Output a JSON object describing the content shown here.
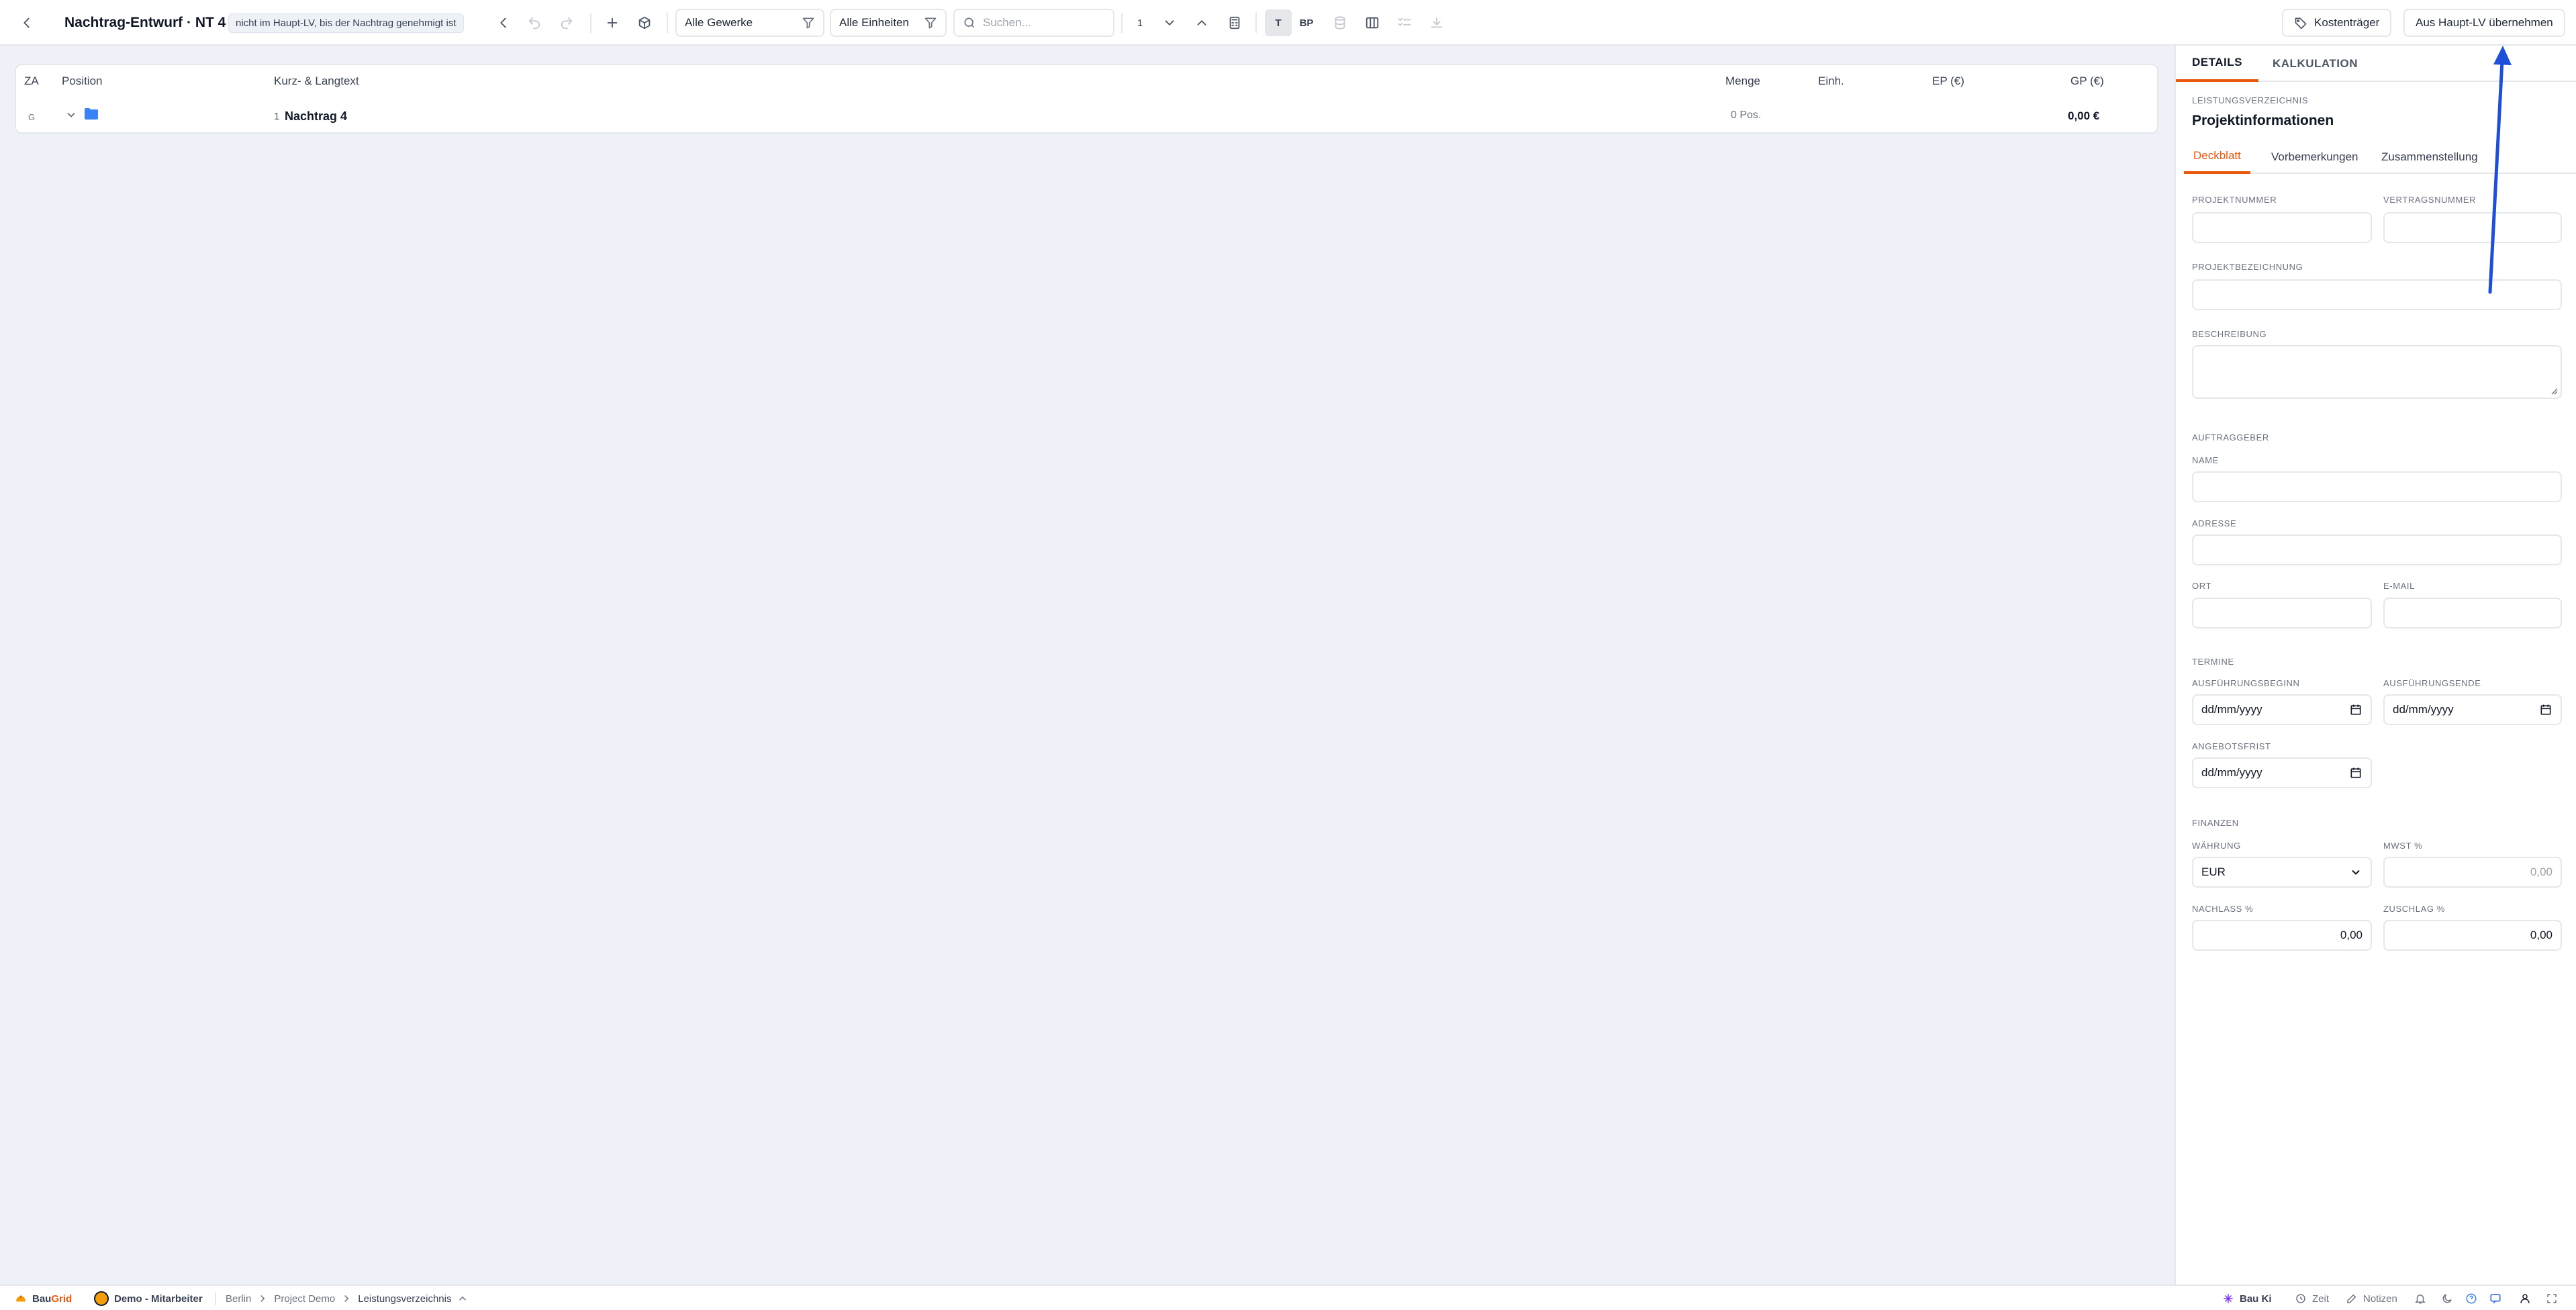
{
  "header": {
    "title": "Nachtrag-Entwurf · NT 4",
    "badge": "nicht im Haupt-LV, bis der Nachtrag genehmigt ist",
    "filter_trades": "Alle Gewerke",
    "filter_units": "Alle Einheiten",
    "search_placeholder": "Suchen...",
    "level_value": "1",
    "toggle_t": "T",
    "toggle_bp": "BP",
    "cost_center_button": "Kostenträger",
    "import_button": "Aus Haupt-LV übernehmen"
  },
  "table": {
    "columns": {
      "za": "ZA",
      "position": "Position",
      "text": "Kurz- & Langtext",
      "quantity": "Menge",
      "unit": "Einh.",
      "ep": "EP (€)",
      "gp": "GP (€)"
    },
    "rows": [
      {
        "za": "G",
        "number": "1",
        "title": "Nachtrag 4",
        "quantity": "0 Pos.",
        "gp": "0,00 €"
      }
    ]
  },
  "panel": {
    "tabs": [
      "DETAILS",
      "KALKULATION"
    ],
    "section_label": "LEISTUNGSVERZEICHNIS",
    "section_title": "Projektinformationen",
    "sub_tabs": [
      "Deckblatt",
      "Vorbemerkungen",
      "Zusammenstellung"
    ],
    "labels": {
      "project_number": "PROJEKTNUMMER",
      "contract_number": "VERTRAGSNUMMER",
      "project_name": "PROJEKTBEZEICHNUNG",
      "description": "BESCHREIBUNG",
      "client": "AUFTRAGGEBER",
      "name": "NAME",
      "address": "ADRESSE",
      "city": "ORT",
      "email": "E-MAIL",
      "dates": "TERMINE",
      "start": "AUSFÜHRUNGSBEGINN",
      "end": "AUSFÜHRUNGSENDE",
      "offer_deadline": "ANGEBOTSFRIST",
      "finance": "FINANZEN",
      "currency": "WÄHRUNG",
      "vat": "MWST %",
      "discount": "NACHLASS %",
      "surcharge": "ZUSCHLAG %"
    },
    "values": {
      "date_placeholder": "dd/mm/yyyy",
      "currency": "EUR",
      "vat_placeholder": "0,00",
      "discount": "0,00",
      "surcharge": "0,00"
    }
  },
  "statusbar": {
    "brand_prefix": "Bau",
    "brand_suffix": "Grid",
    "user": "Demo - Mitarbeiter",
    "breadcrumb": [
      "Berlin",
      "Project Demo",
      "Leistungsverzeichnis"
    ],
    "ai": "Bau Ki",
    "time": "Zeit",
    "notes": "Notizen"
  },
  "colors": {
    "accent": "#ea580c",
    "folder": "#3b82f6",
    "arrow": "#1d4fd8"
  }
}
